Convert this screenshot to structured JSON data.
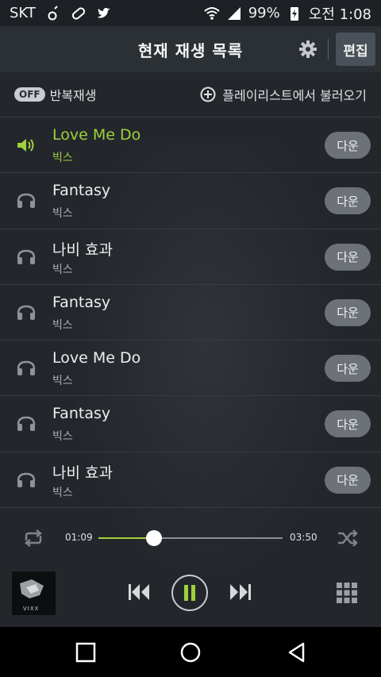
{
  "status_bar": {
    "carrier": "SKT",
    "battery": "99%",
    "time": "오전 1:08"
  },
  "header": {
    "title": "현재 재생 목록",
    "edit_label": "편집"
  },
  "options": {
    "repeat_badge": "OFF",
    "repeat_label": "반복재생",
    "load_playlist_label": "플레이리스트에서 불러오기"
  },
  "playlist": [
    {
      "song": "Love Me Do",
      "artist": "빅스",
      "download_label": "다운",
      "active": true
    },
    {
      "song": "Fantasy",
      "artist": "빅스",
      "download_label": "다운",
      "active": false
    },
    {
      "song": "나비 효과",
      "artist": "빅스",
      "download_label": "다운",
      "active": false
    },
    {
      "song": "Fantasy",
      "artist": "빅스",
      "download_label": "다운",
      "active": false
    },
    {
      "song": "Love Me Do",
      "artist": "빅스",
      "download_label": "다운",
      "active": false
    },
    {
      "song": "Fantasy",
      "artist": "빅스",
      "download_label": "다운",
      "active": false
    },
    {
      "song": "나비 효과",
      "artist": "빅스",
      "download_label": "다운",
      "active": false
    }
  ],
  "player": {
    "elapsed": "01:09",
    "duration": "03:50",
    "progress_fraction": 0.3,
    "album_text": "VIXX"
  },
  "colors": {
    "accent": "#9ed13c",
    "background": "#23272c",
    "button": "#6c7278"
  }
}
